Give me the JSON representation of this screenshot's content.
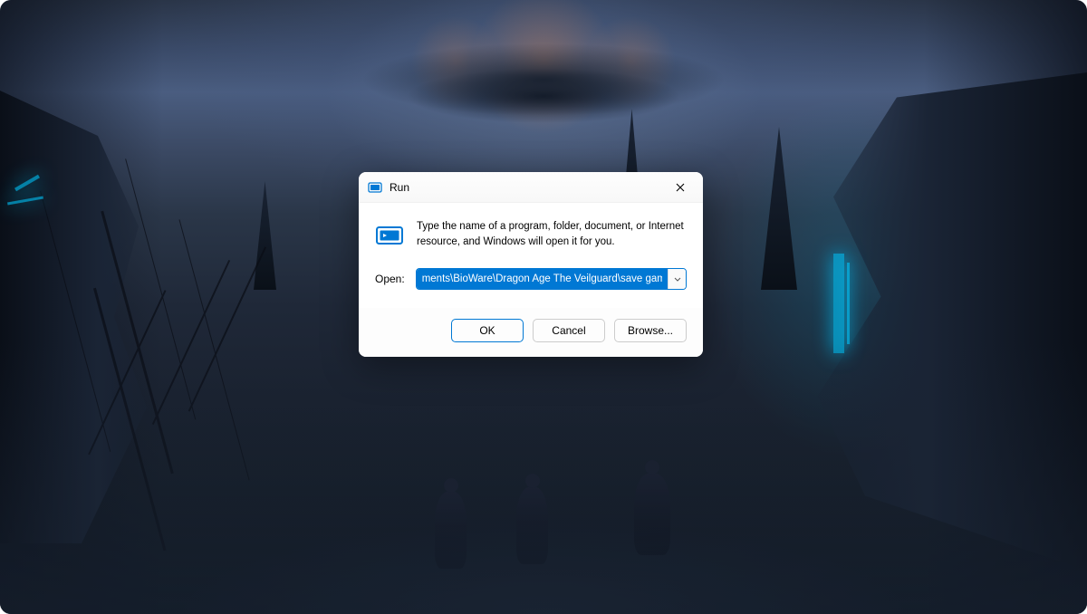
{
  "dialog": {
    "title": "Run",
    "description": "Type the name of a program, folder, document, or Internet resource, and Windows will open it for you.",
    "open_label": "Open:",
    "input_value": "ments\\BioWare\\Dragon Age The Veilguard\\save games\\",
    "buttons": {
      "ok": "OK",
      "cancel": "Cancel",
      "browse": "Browse..."
    }
  }
}
